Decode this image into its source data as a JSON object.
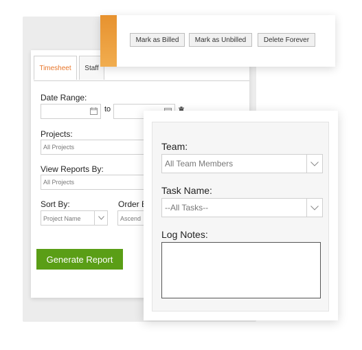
{
  "report_form": {
    "tabs": [
      {
        "label": "Timesheet",
        "active": true
      },
      {
        "label": "Staff",
        "active": false
      }
    ],
    "date_range_label": "Date Range:",
    "to_label": "to",
    "projects_label": "Projects:",
    "projects_value": "All Projects",
    "view_reports_by_label": "View Reports By:",
    "view_reports_by_value": "All Projects",
    "sort_by_label": "Sort By:",
    "sort_by_value": "Project Name",
    "order_by_label": "Order B",
    "order_by_value": "Ascend",
    "generate_button": "Generate Report"
  },
  "actions": {
    "mark_billed": "Mark as Billed",
    "mark_unbilled": "Mark as Unbilled",
    "delete_forever": "Delete Forever"
  },
  "filter_panel": {
    "team_label": "Team:",
    "team_value": "All Team Members",
    "task_label": "Task Name:",
    "task_value": "--All Tasks--",
    "log_notes_label": "Log Notes:",
    "log_notes_value": ""
  },
  "colors": {
    "accent_orange": "#e8762a",
    "button_green": "#5a9e16"
  }
}
